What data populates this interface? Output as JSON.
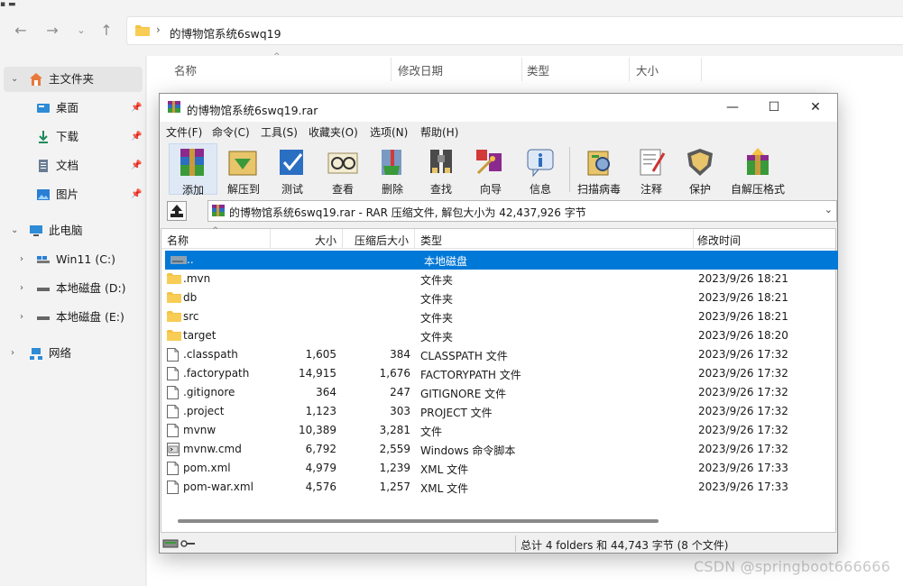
{
  "explorer": {
    "address_path": "的博物馆系统6swq19",
    "columns": [
      "名称",
      "修改日期",
      "类型",
      "大小"
    ],
    "sidebar": [
      {
        "label": "主文件夹",
        "icon": "home-icon"
      },
      {
        "label": "桌面",
        "icon": "desktop-icon"
      },
      {
        "label": "下载",
        "icon": "download-icon"
      },
      {
        "label": "文档",
        "icon": "document-icon"
      },
      {
        "label": "图片",
        "icon": "picture-icon"
      },
      {
        "label": "此电脑",
        "icon": "computer-icon"
      },
      {
        "label": "Win11 (C:)",
        "icon": "windows-drive-icon"
      },
      {
        "label": "本地磁盘 (D:)",
        "icon": "drive-icon"
      },
      {
        "label": "本地磁盘 (E:)",
        "icon": "drive-icon"
      },
      {
        "label": "网络",
        "icon": "network-icon"
      }
    ]
  },
  "rar": {
    "title": "的博物馆系统6swq19.rar",
    "menu": [
      "文件(F)",
      "命令(C)",
      "工具(S)",
      "收藏夹(O)",
      "选项(N)",
      "帮助(H)"
    ],
    "toolbar": [
      "添加",
      "解压到",
      "测试",
      "查看",
      "删除",
      "查找",
      "向导",
      "信息",
      "扫描病毒",
      "注释",
      "保护",
      "自解压格式"
    ],
    "path_text": "的博物馆系统6swq19.rar - RAR 压缩文件, 解包大小为 42,437,926 字节",
    "columns": [
      "名称",
      "大小",
      "压缩后大小",
      "类型",
      "修改时间"
    ],
    "rows": [
      {
        "name": "..",
        "size": "",
        "packed": "",
        "type": "本地磁盘",
        "modified": "",
        "icon": "folder"
      },
      {
        "name": ".mvn",
        "size": "",
        "packed": "",
        "type": "文件夹",
        "modified": "2023/9/26 18:21",
        "icon": "folder"
      },
      {
        "name": "db",
        "size": "",
        "packed": "",
        "type": "文件夹",
        "modified": "2023/9/26 18:21",
        "icon": "folder"
      },
      {
        "name": "src",
        "size": "",
        "packed": "",
        "type": "文件夹",
        "modified": "2023/9/26 18:21",
        "icon": "folder"
      },
      {
        "name": "target",
        "size": "",
        "packed": "",
        "type": "文件夹",
        "modified": "2023/9/26 18:20",
        "icon": "folder"
      },
      {
        "name": ".classpath",
        "size": "1,605",
        "packed": "384",
        "type": "CLASSPATH 文件",
        "modified": "2023/9/26 17:32",
        "icon": "file"
      },
      {
        "name": ".factorypath",
        "size": "14,915",
        "packed": "1,676",
        "type": "FACTORYPATH 文件",
        "modified": "2023/9/26 17:32",
        "icon": "file"
      },
      {
        "name": ".gitignore",
        "size": "364",
        "packed": "247",
        "type": "GITIGNORE 文件",
        "modified": "2023/9/26 17:32",
        "icon": "file"
      },
      {
        "name": ".project",
        "size": "1,123",
        "packed": "303",
        "type": "PROJECT 文件",
        "modified": "2023/9/26 17:32",
        "icon": "file"
      },
      {
        "name": "mvnw",
        "size": "10,389",
        "packed": "3,281",
        "type": "文件",
        "modified": "2023/9/26 17:32",
        "icon": "file"
      },
      {
        "name": "mvnw.cmd",
        "size": "6,792",
        "packed": "2,559",
        "type": "Windows 命令脚本",
        "modified": "2023/9/26 17:32",
        "icon": "cmd"
      },
      {
        "name": "pom.xml",
        "size": "4,979",
        "packed": "1,239",
        "type": "XML 文件",
        "modified": "2023/9/26 17:33",
        "icon": "file"
      },
      {
        "name": "pom-war.xml",
        "size": "4,576",
        "packed": "1,257",
        "type": "XML 文件",
        "modified": "2023/9/26 17:33",
        "icon": "file"
      }
    ],
    "status_text": "总计 4 folders 和 44,743 字节 (8 个文件)"
  },
  "watermark": "CSDN @springboot666666",
  "colors": {
    "selection": "#0078d7",
    "folder": "#f6c244",
    "window_bg": "#f0f0f0"
  }
}
